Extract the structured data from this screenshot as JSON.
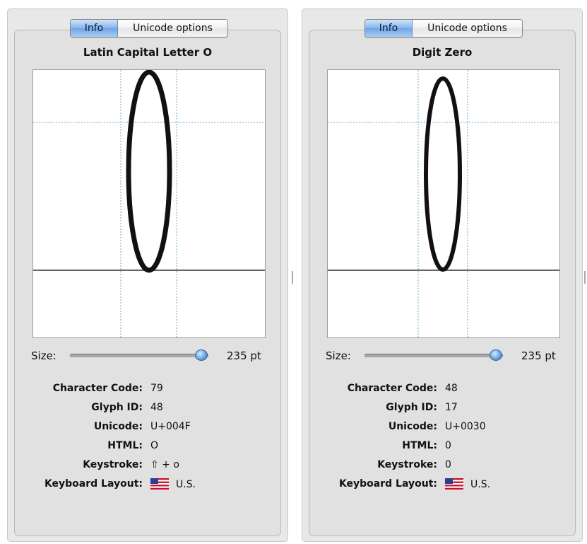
{
  "colors": {
    "panel_bg": "#e8e8e8",
    "glyph_stroke": "#111111",
    "guide_line": "#6fa9c4",
    "flag_red": "#c8102e",
    "flag_blue": "#2a3f8f"
  },
  "panels": [
    {
      "tabs": {
        "info": "Info",
        "unicode": "Unicode options"
      },
      "title": "Latin Capital Letter O",
      "size": {
        "label": "Size:",
        "value": "235 pt",
        "slider_fraction": 0.92
      },
      "info": [
        {
          "label": "Character Code:",
          "value": "79"
        },
        {
          "label": "Glyph ID:",
          "value": "48"
        },
        {
          "label": "Unicode:",
          "value": "U+004F"
        },
        {
          "label": "HTML:",
          "value": "O"
        },
        {
          "label": "Keystroke:",
          "value": "⇧ + o"
        },
        {
          "label": "Keyboard Layout:",
          "value": "U.S.",
          "icon": "us-flag-icon"
        }
      ]
    },
    {
      "tabs": {
        "info": "Info",
        "unicode": "Unicode options"
      },
      "title": "Digit Zero",
      "size": {
        "label": "Size:",
        "value": "235 pt",
        "slider_fraction": 0.92
      },
      "info": [
        {
          "label": "Character Code:",
          "value": "48"
        },
        {
          "label": "Glyph ID:",
          "value": "17"
        },
        {
          "label": "Unicode:",
          "value": "U+0030"
        },
        {
          "label": "HTML:",
          "value": "0"
        },
        {
          "label": "Keystroke:",
          "value": "0"
        },
        {
          "label": "Keyboard Layout:",
          "value": "U.S.",
          "icon": "us-flag-icon"
        }
      ]
    }
  ]
}
